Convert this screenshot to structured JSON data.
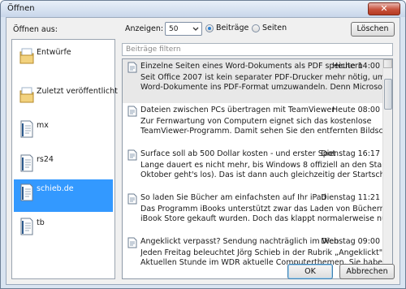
{
  "window": {
    "title": "Öffnen",
    "close_glyph": "✕"
  },
  "sidebar": {
    "label": "Öffnen aus:",
    "items": [
      {
        "label": "Entwürfe",
        "icon": "folder-icon",
        "selected": false
      },
      {
        "label": "Zuletzt veröffentlicht",
        "icon": "folder-icon",
        "selected": false
      },
      {
        "label": "mx",
        "icon": "blog-page-icon",
        "selected": false
      },
      {
        "label": "rs24",
        "icon": "blog-page-icon",
        "selected": false
      },
      {
        "label": "schieb.de",
        "icon": "blog-page-icon",
        "selected": true
      },
      {
        "label": "tb",
        "icon": "blog-page-icon",
        "selected": false
      }
    ]
  },
  "toolbar": {
    "show_label": "Anzeigen:",
    "count_value": "50",
    "radio_posts": "Beiträge",
    "radio_pages": "Seiten",
    "selected_radio": "Beiträge",
    "delete_label": "Löschen"
  },
  "filter": {
    "placeholder": "Beiträge filtern"
  },
  "posts": [
    {
      "title": "Einzelne Seiten eines Word-Dokuments als PDF speichern",
      "date": "Heute 14:00",
      "lines": [
        "Seit Office 2007 ist kein separater PDF-Drucker mehr nötig, um",
        "Word-Dokumente ins PDF-Format umzuwandeln. Denn Microsoft hat einen"
      ]
    },
    {
      "title": "Dateien zwischen PCs übertragen mit TeamViewer",
      "date": "Heute 08:00",
      "lines": [
        "Zur Fernwartung von Computern eignet sich das kostenlose",
        "TeamViewer-Programm. Damit sehen Sie den entfernten Bildschirm so, als"
      ]
    },
    {
      "title": "Surface soll ab 500 Dollar kosten - und erster Spot",
      "date": "Dienstag 16:17",
      "lines": [
        "Lange dauert es nicht mehr, bis Windows 8 offiziell an den Start geht (am 26.",
        "Oktober geht's los). Das ist dann auch gleichzeitig der Startschuss für"
      ]
    },
    {
      "title": "So laden Sie Bücher am einfachsten auf Ihr iPad",
      "date": "Dienstag 11:21",
      "lines": [
        "Das Programm iBooks unterstützt zwar das Laden von Büchern, die nicht im",
        "iBook Store gekauft wurden. Doch das klappt normalerweise nur via iTunes"
      ]
    },
    {
      "title": "Angeklickt verpasst? Sendung nachträglich im Web",
      "date": "Dienstag 09:00",
      "lines": [
        "Jeden Freitag beleuchtet Jörg Schieb in der Rubrik „Angeklickt\" der",
        "Aktuellen Stunde im WDR aktuelle Computerthemen. Sie haben die Sendung"
      ]
    }
  ],
  "footer": {
    "ok_label": "OK",
    "cancel_label": "Abbrechen"
  }
}
